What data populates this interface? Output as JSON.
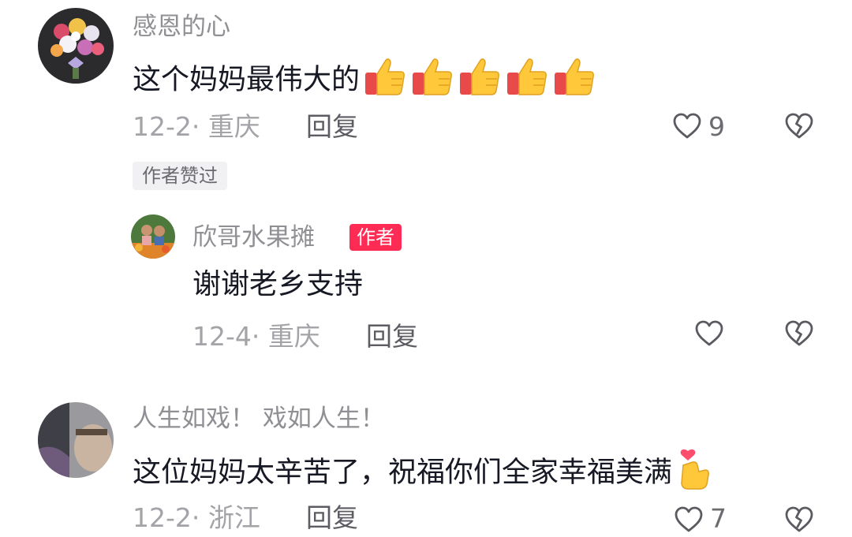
{
  "comments": [
    {
      "username": "感恩的心",
      "text": "这个妈妈最伟大的",
      "emoji_icons": [
        "thumbs-up-icon",
        "thumbs-up-icon",
        "thumbs-up-icon",
        "thumbs-up-icon",
        "thumbs-up-icon"
      ],
      "date_location": "12-2· 重庆",
      "reply_label": "回复",
      "like_count": "9",
      "liked_badge": "作者赞过",
      "reply": {
        "username": "欣哥水果摊",
        "author_badge": "作者",
        "text": "谢谢老乡支持",
        "date_location": "12-4· 重庆",
        "reply_label": "回复"
      }
    },
    {
      "username": "人生如戏！ 戏如人生！",
      "text": "这位妈妈太辛苦了，祝福你们全家幸福美满",
      "emoji_icons": [
        "finger-heart-icon"
      ],
      "date_location": "12-2· 浙江",
      "reply_label": "回复",
      "like_count": "7"
    }
  ],
  "icons": {
    "like": "heart-outline-icon",
    "dislike": "broken-heart-icon"
  },
  "colors": {
    "author_badge": "#fe2c55",
    "username": "#8f8f94",
    "text": "#161823"
  }
}
